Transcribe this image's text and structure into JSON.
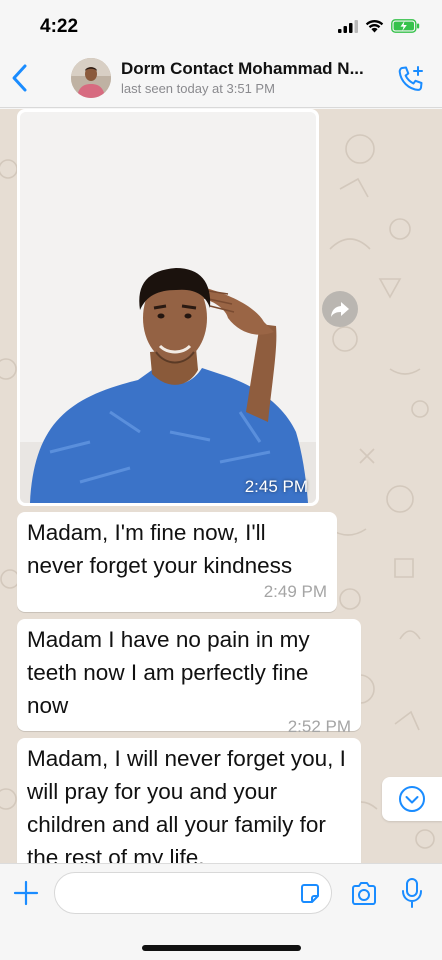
{
  "status_bar": {
    "time": "4:22",
    "icons": [
      "signal-icon",
      "wifi-icon",
      "battery-charging-icon"
    ]
  },
  "header": {
    "contact_name": "Dorm Contact Mohammad N...",
    "last_seen": "last seen today at 3:51 PM",
    "icons": {
      "back": "chevron-left-icon",
      "call": "phone-plus-icon"
    }
  },
  "messages": [
    {
      "type": "image",
      "description": "selfie-photo",
      "time": "2:45 PM"
    },
    {
      "type": "text",
      "text": "Madam, I'm fine now, I'll never forget your kindness",
      "time": "2:49 PM"
    },
    {
      "type": "text",
      "text": "Madam I have no pain in my teeth now I am perfectly fine now",
      "time": "2:52 PM"
    },
    {
      "type": "text",
      "text": "Madam, I will never forget you, I will pray for you and your children and all your family for the rest of my life.",
      "time": ""
    }
  ],
  "input_bar": {
    "placeholder": "",
    "icons": {
      "attach": "plus-icon",
      "sticker": "sticker-icon",
      "camera": "camera-icon",
      "mic": "microphone-icon"
    }
  },
  "colors": {
    "accent": "#1a8cff",
    "chat_background": "#e6ddd3",
    "bubble": "#ffffff",
    "timestamp": "#a5a5a5",
    "battery": "#36c24b"
  }
}
